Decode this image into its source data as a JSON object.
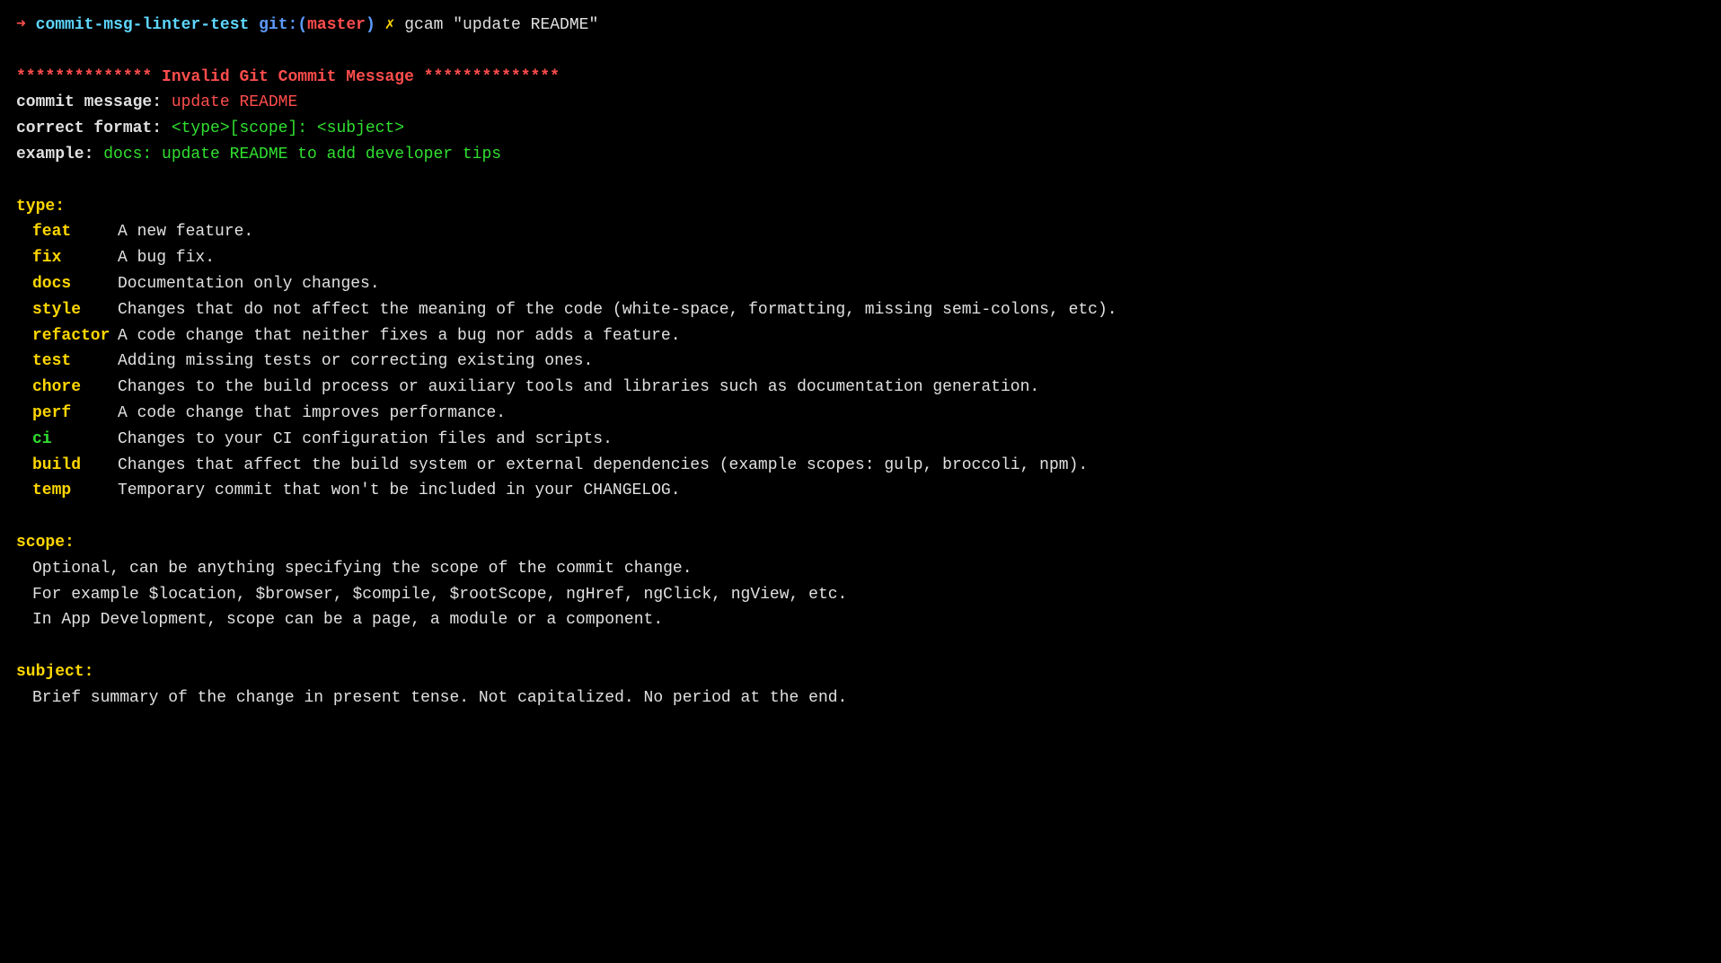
{
  "prompt": {
    "arrow": "➜",
    "dir": "commit-msg-linter-test",
    "git_label": "git:(",
    "branch": "master",
    "git_close": ")",
    "lightning": "✗",
    "command": "gcam \"update README\""
  },
  "header": {
    "stars_left": "**************",
    "title": " Invalid Git Commit Message ",
    "stars_right": "**************"
  },
  "commit_message": {
    "label": "commit message: ",
    "value": "update README"
  },
  "correct_format": {
    "label": "correct format: ",
    "value": "<type>[scope]: <subject>"
  },
  "example": {
    "label": "example: ",
    "value": "docs: update README to add developer tips"
  },
  "type_section": {
    "heading": "type:",
    "types": [
      {
        "name": "feat",
        "color": "yellow",
        "desc": "A new feature."
      },
      {
        "name": "fix",
        "color": "yellow",
        "desc": "A bug fix."
      },
      {
        "name": "docs",
        "color": "yellow",
        "desc": "Documentation only changes."
      },
      {
        "name": "style",
        "color": "yellow",
        "desc": "Changes that do not affect the meaning of the code (white-space, formatting, missing semi-colons, etc)."
      },
      {
        "name": "refactor",
        "color": "yellow",
        "desc": "A code change that neither fixes a bug nor adds a feature."
      },
      {
        "name": "test",
        "color": "yellow",
        "desc": "Adding missing tests or correcting existing ones."
      },
      {
        "name": "chore",
        "color": "yellow",
        "desc": "Changes to the build process or auxiliary tools and libraries such as documentation generation."
      },
      {
        "name": "perf",
        "color": "yellow",
        "desc": "A code change that improves performance."
      },
      {
        "name": "ci",
        "color": "green",
        "desc": "Changes to your CI configuration files and scripts."
      },
      {
        "name": "build",
        "color": "yellow",
        "desc": "Changes that affect the build system or external dependencies (example scopes: gulp, broccoli, npm)."
      },
      {
        "name": "temp",
        "color": "yellow",
        "desc": "Temporary commit that won't be included in your CHANGELOG."
      }
    ]
  },
  "scope_section": {
    "heading": "scope:",
    "lines": [
      "Optional, can be anything specifying the scope of the commit change.",
      "For example $location, $browser, $compile, $rootScope, ngHref, ngClick, ngView, etc.",
      "In App Development, scope can be a page, a module or a component."
    ]
  },
  "subject_section": {
    "heading": "subject:",
    "lines": [
      "Brief summary of the change in present tense. Not capitalized. No period at the end."
    ]
  }
}
